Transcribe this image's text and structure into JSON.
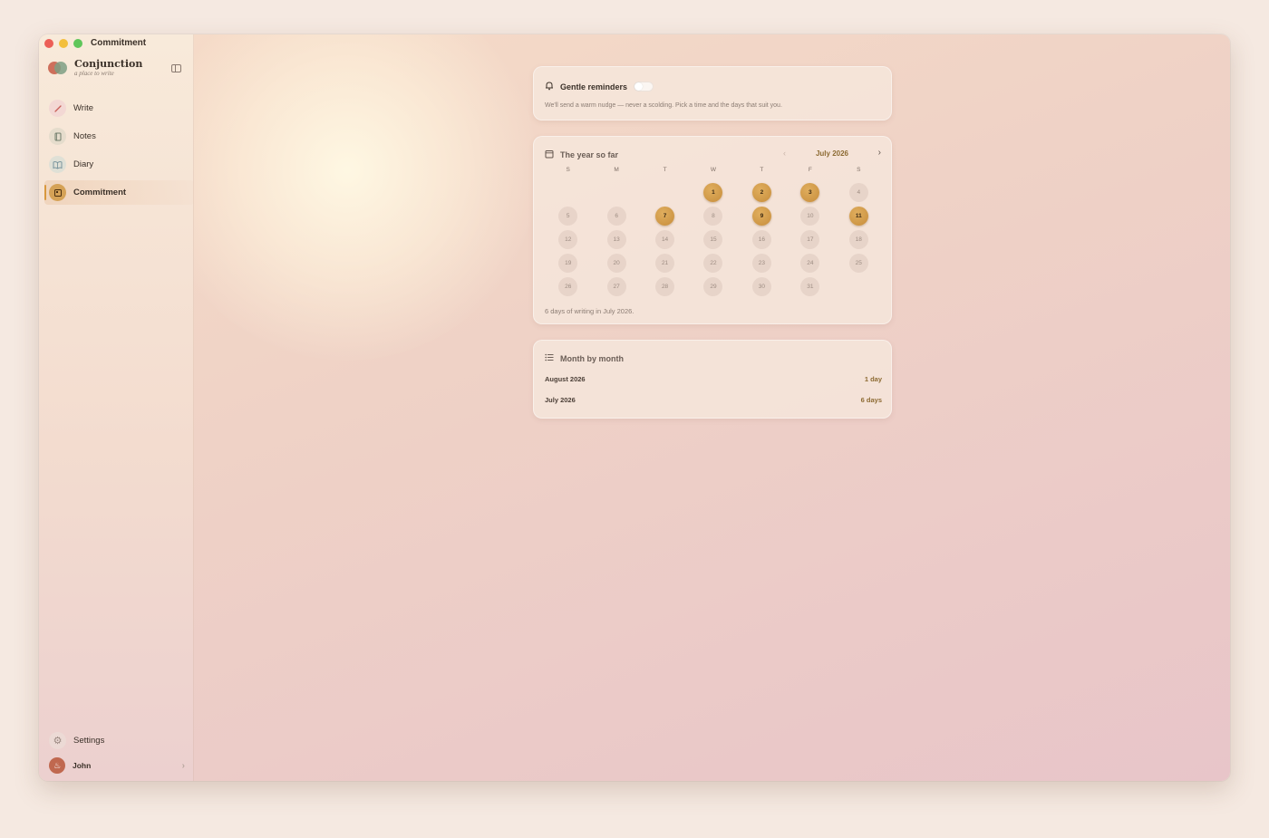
{
  "window": {
    "title": "Commitment"
  },
  "brand": {
    "name": "Conjunction",
    "tagline": "a place to write"
  },
  "sidebar": {
    "items": [
      {
        "label": "Write",
        "icon": "pencil-icon"
      },
      {
        "label": "Notes",
        "icon": "notebook-icon"
      },
      {
        "label": "Diary",
        "icon": "book-open-icon"
      },
      {
        "label": "Commitment",
        "icon": "calendar-book-icon",
        "active": true
      }
    ],
    "settings_label": "Settings",
    "user_name": "John"
  },
  "reminders": {
    "title": "Gentle reminders",
    "enabled": false,
    "description": "We'll send a warm nudge — never a scolding. Pick a time and the days that suit you."
  },
  "calendar": {
    "title": "The year so far",
    "month_label": "July 2026",
    "weekdays": [
      "S",
      "M",
      "T",
      "W",
      "T",
      "F",
      "S"
    ],
    "leading_blank_days": 3,
    "days_in_month": 31,
    "written_days": [
      1,
      2,
      3,
      7,
      9,
      11
    ],
    "summary": "6 days of writing in July 2026."
  },
  "month_by_month": {
    "title": "Month by month",
    "rows": [
      {
        "month": "August 2026",
        "count": "1 day"
      },
      {
        "month": "July 2026",
        "count": "6 days"
      }
    ]
  },
  "colors": {
    "accent": "#d8983e",
    "written_day": "#c78d3b",
    "background": "#f5e9e1"
  }
}
